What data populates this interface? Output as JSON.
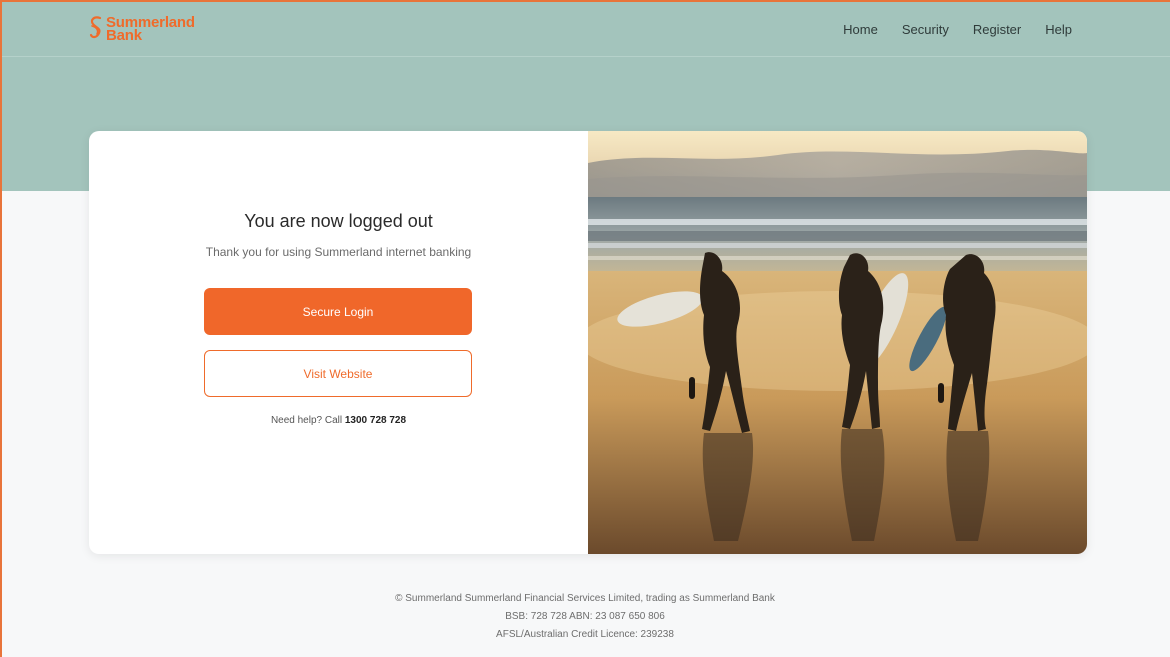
{
  "brand": {
    "name_line1": "Summerland",
    "name_line2": "Bank",
    "accent_color": "#ef6b2b",
    "hero_color": "#a3c4bc"
  },
  "nav": {
    "items": [
      {
        "label": "Home"
      },
      {
        "label": "Security"
      },
      {
        "label": "Register"
      },
      {
        "label": "Help"
      }
    ]
  },
  "logout": {
    "title": "You are now logged out",
    "subtitle": "Thank you for using Summerland internet banking",
    "primary_button": "Secure Login",
    "secondary_button": "Visit Website",
    "help_prefix": "Need help? Call ",
    "help_phone": "1300 728 728"
  },
  "image": {
    "icon": "beach-surfers-photo"
  },
  "footer": {
    "line1": "© Summerland Summerland Financial Services Limited, trading as Summerland Bank",
    "line2": "BSB: 728 728 ABN: 23 087 650 806",
    "line3": "AFSL/Australian Credit Licence: 239238"
  }
}
